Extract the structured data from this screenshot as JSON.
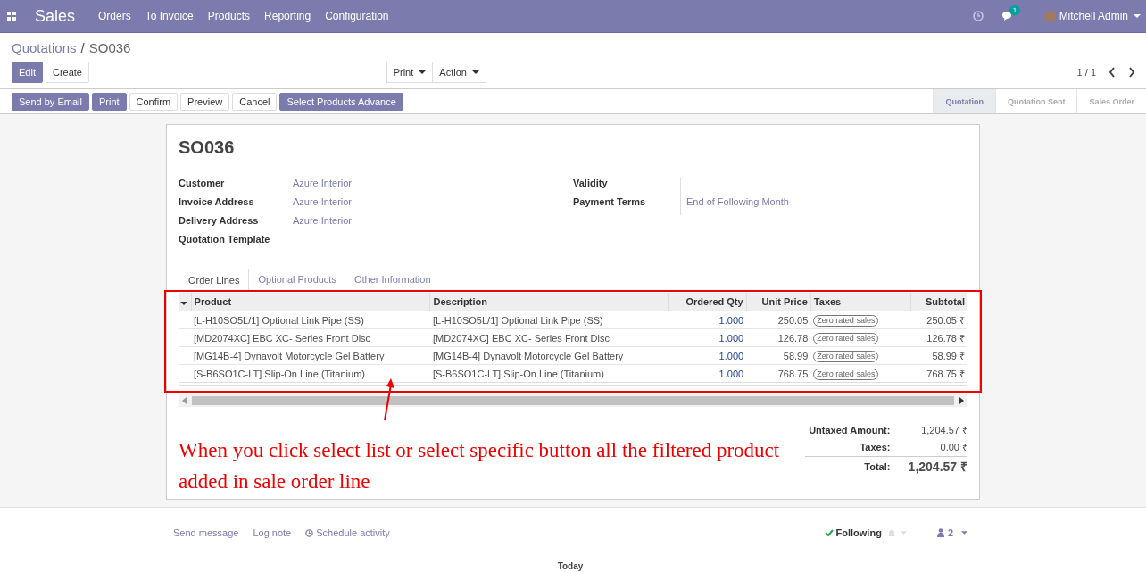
{
  "navbar": {
    "app": "Sales",
    "menu": [
      "Orders",
      "To Invoice",
      "Products",
      "Reporting",
      "Configuration"
    ],
    "messages_badge": "1",
    "user": "Mitchell Admin"
  },
  "breadcrumb": {
    "parent": "Quotations",
    "separator": "/",
    "current": "SO036"
  },
  "edit_buttons": [
    {
      "label": "Edit",
      "primary": true
    },
    {
      "label": "Create",
      "primary": false
    }
  ],
  "dropdowns": [
    "Print",
    "Action"
  ],
  "pager": "1 / 1",
  "action_buttons": [
    {
      "label": "Send by Email",
      "primary": true
    },
    {
      "label": "Print",
      "primary": true
    },
    {
      "label": "Confirm",
      "primary": false
    },
    {
      "label": "Preview",
      "primary": false
    },
    {
      "label": "Cancel",
      "primary": false
    },
    {
      "label": "Select Products Advance",
      "primary": true
    }
  ],
  "status_steps": [
    {
      "label": "Quotation",
      "selected": true
    },
    {
      "label": "Quotation Sent",
      "selected": false
    },
    {
      "label": "Sales Order",
      "selected": false
    }
  ],
  "title": "SO036",
  "fields_left": [
    {
      "label": "Customer",
      "value": "Azure Interior"
    },
    {
      "label": "Invoice Address",
      "value": "Azure Interior"
    },
    {
      "label": "Delivery Address",
      "value": "Azure Interior"
    },
    {
      "label": "Quotation Template"
    }
  ],
  "fields_right": [
    {
      "label": "Validity"
    },
    {
      "label": "Payment Terms",
      "value": "End of Following Month"
    }
  ],
  "tabs": [
    {
      "label": "Order Lines",
      "selected": true
    },
    {
      "label": "Optional Products",
      "selected": false
    },
    {
      "label": "Other Information",
      "selected": false
    }
  ],
  "table": {
    "columns": [
      "Product",
      "Description",
      "Ordered Qty",
      "Unit Price",
      "Taxes",
      "Subtotal"
    ],
    "rows": [
      {
        "product": "[L-H10SO5L/1] Optional Link Pipe (SS)",
        "description": "[L-H10SO5L/1] Optional Link Pipe (SS)",
        "qty": "1.000",
        "price": "250.05",
        "tax": "Zero rated sales",
        "subtotal": "250.05 ₹"
      },
      {
        "product": "[MD2074XC] EBC XC- Series Front Disc",
        "description": "[MD2074XC] EBC XC- Series Front Disc",
        "qty": "1.000",
        "price": "126.78",
        "tax": "Zero rated sales",
        "subtotal": "126.78 ₹"
      },
      {
        "product": "[MG14B-4] Dynavolt Motorcycle Gel Battery",
        "description": "[MG14B-4] Dynavolt Motorcycle Gel Battery",
        "qty": "1.000",
        "price": "58.99",
        "tax": "Zero rated sales",
        "subtotal": "58.99 ₹"
      },
      {
        "product": "[S-B6SO1C-LT] Slip-On Line (Titanium)",
        "description": "[S-B6SO1C-LT] Slip-On Line (Titanium)",
        "qty": "1.000",
        "price": "768.75",
        "tax": "Zero rated sales",
        "subtotal": "768.75 ₹"
      }
    ]
  },
  "totals": [
    {
      "label": "Untaxed Amount:",
      "value": "1,204.57 ₹",
      "kind": "line"
    },
    {
      "label": "Taxes:",
      "value": "0.00 ₹",
      "kind": "line"
    },
    {
      "label": "Total:",
      "value": "1,204.57 ₹",
      "kind": "grand"
    }
  ],
  "annotation": "When you click select list or select specific button all the filtered product added in sale order line",
  "chatter": {
    "actions": [
      "Send message",
      "Log note",
      "Schedule activity"
    ],
    "following": "Following",
    "followers": "2"
  },
  "date_separator": "Today"
}
